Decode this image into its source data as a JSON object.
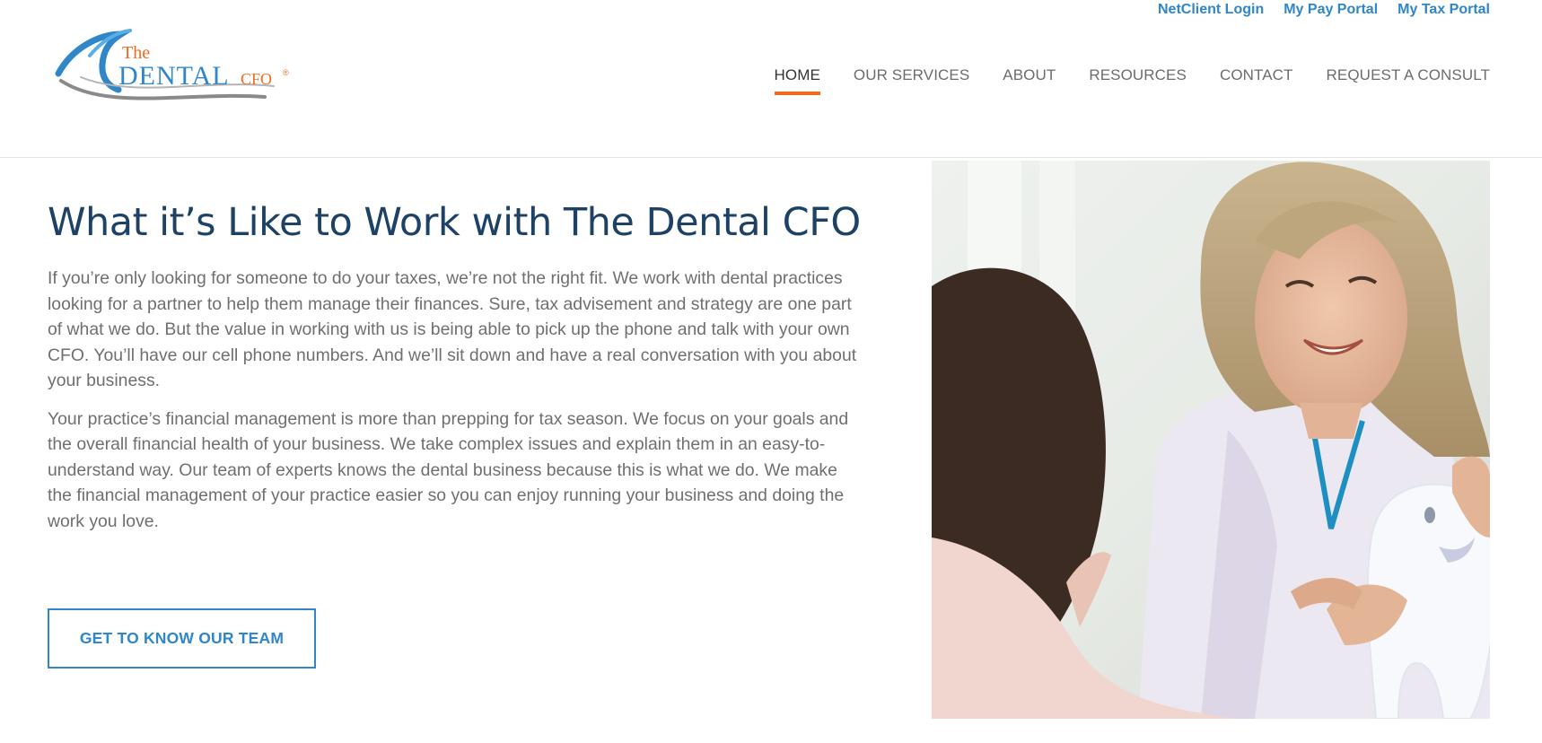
{
  "brand": {
    "logo_word_the": "The",
    "logo_word_dental": "DENTAL",
    "logo_word_cfo": "CFO",
    "logo_mark": "®",
    "colors": {
      "primary_blue": "#2f86c8",
      "accent_orange": "#f26b1d",
      "headline_navy": "#1d4265"
    }
  },
  "top_links": [
    {
      "label": "NetClient Login"
    },
    {
      "label": "My Pay Portal"
    },
    {
      "label": "My Tax Portal"
    }
  ],
  "nav": {
    "items": [
      {
        "label": "HOME",
        "active": true
      },
      {
        "label": "OUR SERVICES"
      },
      {
        "label": "ABOUT"
      },
      {
        "label": "RESOURCES"
      },
      {
        "label": "CONTACT"
      },
      {
        "label": "REQUEST A CONSULT"
      }
    ]
  },
  "hero": {
    "headline": "What it’s Like to Work with The Dental CFO",
    "paragraphs": [
      "If you’re only looking for someone to do your taxes, we’re not the right fit. We work with dental practices looking for a partner to help them manage their finances. Sure, tax advisement and strategy are one part of what we do. But the value in working with us is being able to pick up the phone and talk with your own CFO. You’ll have our cell phone numbers. And we’ll sit down and have a real conversation with you about your business.",
      "Your practice’s financial management is more than prepping for tax season. We focus on your goals and the overall financial health of your business. We take complex issues and explain them in an easy-to-understand way. Our team of experts knows the dental business because this is what we do. We make the financial management of your practice easier so you can enjoy running your business and doing the work you love."
    ],
    "cta_label": "GET TO KNOW OUR TEAM",
    "photo_icon": "dentist-with-child-photo"
  }
}
